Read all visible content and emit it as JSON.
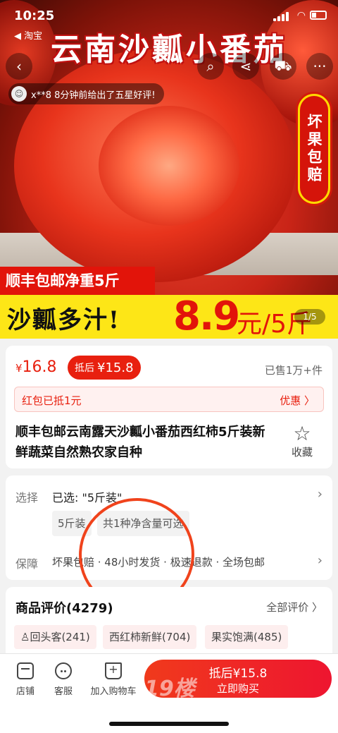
{
  "status": {
    "time": "10:25",
    "back_app": "◀ 淘宝"
  },
  "hero": {
    "title": "云南沙瓤小番茄",
    "review_ticker": "x**8 8分钟前给出了五星好评!",
    "seal_text": "坏果包赔",
    "red_banner": "顺丰包邮净重5斤",
    "yellow_text": "沙瓤多汁!",
    "yellow_price": "8.9",
    "yellow_unit": "元/5斤",
    "page_indicator": "1/5"
  },
  "price": {
    "currency": "¥",
    "current": "16.8",
    "after_label": "抵后",
    "after_value": "¥15.8",
    "sold": "已售1万+件",
    "coupon_left": "红包已抵1元",
    "coupon_right": "优惠 〉",
    "title": "顺丰包邮云南露天沙瓤小番茄西红柿5斤装新鲜蔬菜自然熟农家自种",
    "favorite_label": "收藏"
  },
  "options": {
    "select_label": "选择",
    "select_value": "已选: \"5斤装\"",
    "chips": [
      "5斤装",
      "共1种净含量可选"
    ],
    "guarantee_label": "保障",
    "guarantee_value": "坏果包赔 · 48小时发货 · 极速退款 · 全场包邮"
  },
  "reviews": {
    "title": "商品评价(4279)",
    "all_label": "全部评价 〉",
    "tags": [
      "♙回头客(241)",
      "西红柿新鲜(704)",
      "果实饱满(485)"
    ]
  },
  "bottom_bar": {
    "store": "店铺",
    "service": "客服",
    "add_cart": "加入购物车",
    "buy_price": "抵后¥15.8",
    "buy_label": "立即购买",
    "watermark": "19楼"
  },
  "colors": {
    "accent": "#e8200f",
    "banner_yellow": "#fde617",
    "annotation": "#f0431c"
  }
}
